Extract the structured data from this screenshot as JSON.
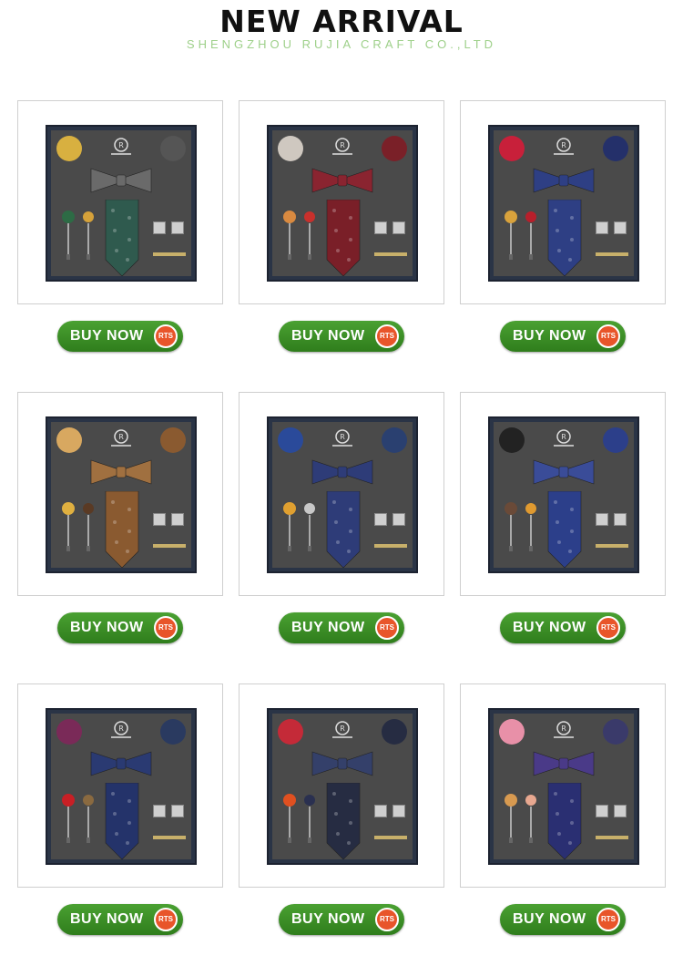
{
  "header": {
    "title": "NEW ARRIVAL",
    "subtitle": "SHENGZHOU RUJIA CRAFT CO.,LTD"
  },
  "product_buttons": {
    "label": "BUY NOW",
    "badge": "RTS"
  },
  "products": [
    {
      "colors": {
        "tie": "#2f5a4e",
        "bowtie": "#6a6a6a",
        "left": "#d8b040",
        "right": "#555555",
        "flower1": "#2d6b45",
        "flower2": "#d6a23a"
      }
    },
    {
      "colors": {
        "tie": "#7a1f28",
        "bowtie": "#8a2430",
        "left": "#cfc8c0",
        "right": "#7a2028",
        "flower1": "#d98a40",
        "flower2": "#c8302c"
      }
    },
    {
      "colors": {
        "tie": "#2e3f84",
        "bowtie": "#2e3f84",
        "left": "#c8203a",
        "right": "#24306a",
        "flower1": "#d9a23c",
        "flower2": "#b81f2b"
      }
    },
    {
      "colors": {
        "tie": "#8a5a30",
        "bowtie": "#a07040",
        "left": "#d8a860",
        "right": "#8a5a30",
        "flower1": "#e0b040",
        "flower2": "#5a3a24"
      }
    },
    {
      "colors": {
        "tie": "#2e3c78",
        "bowtie": "#2e3c78",
        "left": "#2a4a9a",
        "right": "#2a4070",
        "flower1": "#e0a030",
        "flower2": "#c8c8c8"
      }
    },
    {
      "colors": {
        "tie": "#2c3f8a",
        "bowtie": "#3a4c98",
        "left": "#222222",
        "right": "#2c3f8a",
        "flower1": "#6a4a38",
        "flower2": "#e09a30"
      }
    },
    {
      "colors": {
        "tie": "#24336a",
        "bowtie": "#2a3a72",
        "left": "#7a2a58",
        "right": "#2a3a60",
        "flower1": "#c81f25",
        "flower2": "#8a6a40"
      }
    },
    {
      "colors": {
        "tie": "#262c42",
        "bowtie": "#34406a",
        "left": "#c42a38",
        "right": "#262c42",
        "flower1": "#e05020",
        "flower2": "#2a3050"
      }
    },
    {
      "colors": {
        "tie": "#2a2f72",
        "bowtie": "#4a3a88",
        "left": "#e890a8",
        "right": "#3a3a6a",
        "flower1": "#d89a50",
        "flower2": "#e8a890"
      }
    }
  ]
}
